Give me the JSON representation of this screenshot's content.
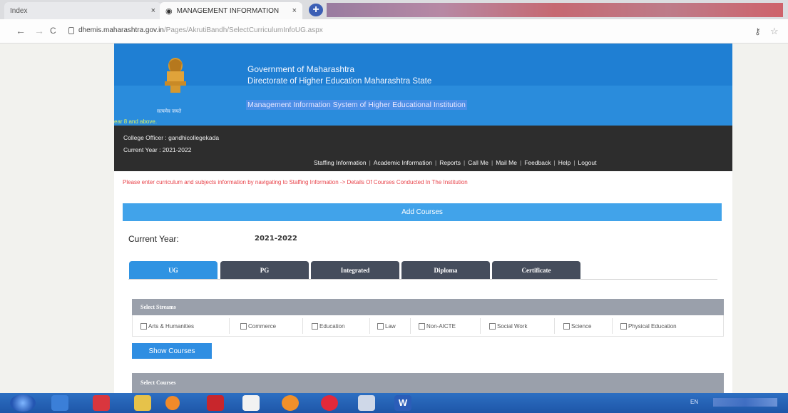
{
  "browser": {
    "tabs": [
      {
        "title": "Index",
        "close": "×"
      },
      {
        "title": "MANAGEMENT INFORMATION",
        "close": "×"
      }
    ],
    "new_tab": "+",
    "url_host": "dhemis.maharashtra.gov.in",
    "url_path": "/Pages/AkrutiBandh/SelectCurriculumInfoUG.aspx",
    "back": "←",
    "forward": "→",
    "reload": "C"
  },
  "header": {
    "emblem_motto": "सत्यमेव जयते",
    "govt": "Government of Maharashtra",
    "directorate": "Directorate of Higher Education Maharashtra State",
    "mis": "Management Information System of Higher Educational Institution",
    "marquee": "ear 8 and above."
  },
  "userbar": {
    "officer": "College Officer : gandhicollegekada",
    "year": "Current Year : 2021-2022",
    "menu": [
      "Staffing Information",
      "Academic Information",
      "Reports",
      "Call Me",
      "Mail Me",
      "Feedback",
      "Help",
      "Logout"
    ]
  },
  "notice": "Please enter curriculum and subjects information by navigating to Staffing Information -> Details Of Courses Conducted In The Institution",
  "main": {
    "panel_title": "Add Courses",
    "current_year_label": "Current Year:",
    "current_year_value": "2021-2022",
    "tabs": [
      "UG",
      "PG",
      "Integrated",
      "Diploma",
      "Certificate"
    ],
    "streams_heading": "Select Streams",
    "streams": [
      "Arts & Humanities",
      "Commerce",
      "Education",
      "Law",
      "Non-AICTE",
      "Social Work",
      "Science",
      "Physical Education"
    ],
    "show_button": "Show Courses",
    "courses_heading": "Select Courses"
  },
  "taskbar": {
    "tray": "EN"
  },
  "colors": {
    "banner": "#1f7fd3",
    "userbar": "#2d2d2d",
    "accent": "#41a3ea",
    "active_tab": "#2f93e2",
    "inactive_tab": "#454d5c",
    "notice": "#e8434a",
    "section_head": "#9aa0ab"
  }
}
